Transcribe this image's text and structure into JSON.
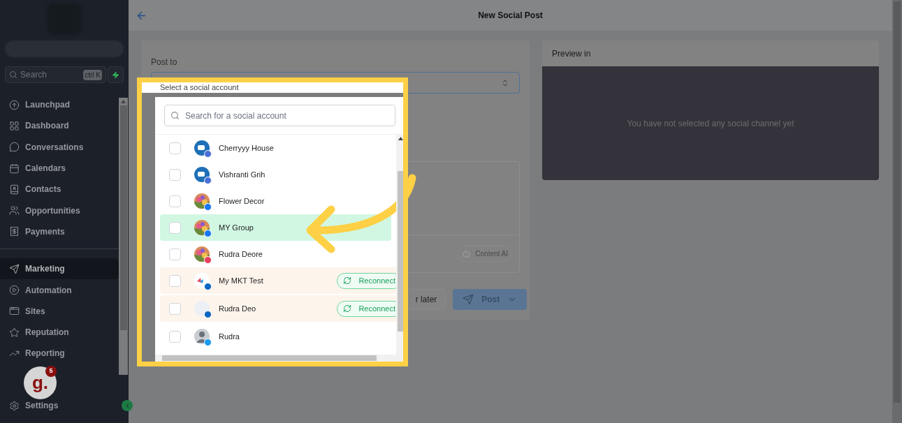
{
  "sidebar": {
    "search": {
      "placeholder": "Search",
      "shortcut": "ctrl K"
    },
    "nav_groups": [
      [
        {
          "label": "Launchpad",
          "selected": false
        },
        {
          "label": "Dashboard",
          "selected": false
        },
        {
          "label": "Conversations",
          "selected": false
        },
        {
          "label": "Calendars",
          "selected": false
        },
        {
          "label": "Contacts",
          "selected": false
        },
        {
          "label": "Opportunities",
          "selected": false
        },
        {
          "label": "Payments",
          "selected": false
        }
      ],
      [
        {
          "label": "Marketing",
          "selected": true
        },
        {
          "label": "Automation",
          "selected": false
        },
        {
          "label": "Sites",
          "selected": false
        },
        {
          "label": "Reputation",
          "selected": false
        },
        {
          "label": "Reporting",
          "selected": false
        }
      ]
    ],
    "settings": {
      "label": "Settings"
    },
    "chat_widget": {
      "logo": "g.",
      "badge": "5"
    }
  },
  "header": {
    "title": "New Social Post"
  },
  "composer": {
    "post_to_label": "Post to",
    "select_placeholder": "Select a social account",
    "content_ai": "Content AI",
    "schedule_button": "r later",
    "post_button": "Post"
  },
  "preview": {
    "title": "Preview in",
    "empty_message": "You have not selected any social channel yet"
  },
  "account_dropdown": {
    "search_placeholder": "Search for a social account",
    "accounts": [
      {
        "name": "Cherryyy House",
        "checked": false,
        "highlighted": false,
        "reconnect": false
      },
      {
        "name": "Vishranti Grih",
        "checked": false,
        "highlighted": false,
        "reconnect": false
      },
      {
        "name": "Flower Decor",
        "checked": false,
        "highlighted": false,
        "reconnect": false
      },
      {
        "name": "MY Group",
        "checked": false,
        "highlighted": true,
        "reconnect": false
      },
      {
        "name": "Rudra Deore",
        "checked": false,
        "highlighted": false,
        "reconnect": false
      },
      {
        "name": "My MKT Test",
        "checked": false,
        "highlighted": false,
        "reconnect": true,
        "reconnect_label": "Reconnect"
      },
      {
        "name": "Rudra Deo",
        "checked": false,
        "highlighted": false,
        "reconnect": true,
        "reconnect_label": "Reconnect"
      },
      {
        "name": "Rudra",
        "checked": false,
        "highlighted": false,
        "reconnect": false
      }
    ]
  }
}
